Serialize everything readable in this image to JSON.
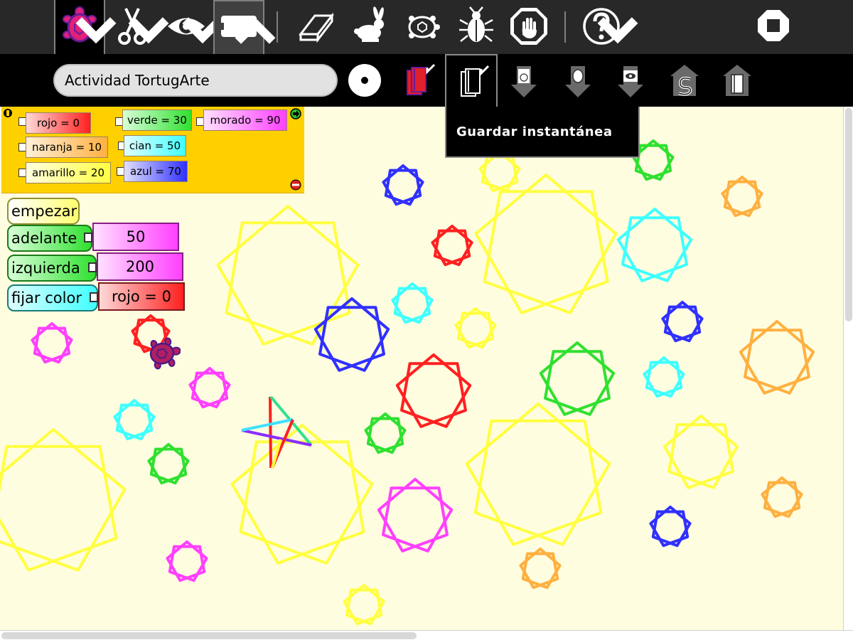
{
  "toolbar": {
    "buttons": [
      {
        "name": "activity-turtle-button",
        "icon": "turtle-icon",
        "state": "selected"
      },
      {
        "name": "edit-button",
        "icon": "scissors-icon"
      },
      {
        "name": "view-button",
        "icon": "eye-icon"
      },
      {
        "name": "palette-button",
        "icon": "palette-blocks-icon",
        "state": "pressed"
      },
      {
        "name": "clean-button",
        "icon": "eraser-icon"
      },
      {
        "name": "run-fast-button",
        "icon": "rabbit-icon"
      },
      {
        "name": "run-slow-button",
        "icon": "turtle-outline-icon"
      },
      {
        "name": "debug-button",
        "icon": "bug-icon"
      },
      {
        "name": "stop-turtle-button",
        "icon": "stop-hand-icon"
      },
      {
        "name": "help-button",
        "icon": "question-icon"
      },
      {
        "name": "stop-activity-button",
        "icon": "stop-icon"
      }
    ]
  },
  "subbar": {
    "title_value": "Actividad TortugArte",
    "buttons": [
      {
        "name": "share-button",
        "icon": "circle-dot-icon"
      },
      {
        "name": "keep-button",
        "icon": "journal-red-icon"
      },
      {
        "name": "save-snapshot-button",
        "icon": "journal-save-icon"
      },
      {
        "name": "save-html-button",
        "icon": "html-export-icon"
      },
      {
        "name": "save-logo-button",
        "icon": "turtle-export-icon"
      },
      {
        "name": "save-image-button",
        "icon": "image-export-icon"
      },
      {
        "name": "save-python-button",
        "icon": "snake-export-icon"
      },
      {
        "name": "load-journal-button",
        "icon": "journal-load-icon"
      }
    ],
    "tooltip": "Guardar instantánea"
  },
  "palette": {
    "colors": {
      "red": "#ff2020",
      "orange": "#ffb040",
      "yellow": "#ffff40",
      "green": "#30e030",
      "cyan": "#40ffff",
      "blue": "#3030ff",
      "purple": "#ff40ff"
    },
    "blocks": [
      {
        "label": "rojo = 0"
      },
      {
        "label": "naranja = 10"
      },
      {
        "label": "amarillo = 20"
      },
      {
        "label": "verde = 30"
      },
      {
        "label": "cian = 50"
      },
      {
        "label": "azul = 70"
      },
      {
        "label": "morado = 90"
      }
    ]
  },
  "program": {
    "start_label": "empezar",
    "forward_label": "adelante",
    "forward_value": "50",
    "left_label": "izquierda",
    "left_value": "200",
    "setcolor_label": "fijar color",
    "setcolor_value": "rojo = 0"
  }
}
